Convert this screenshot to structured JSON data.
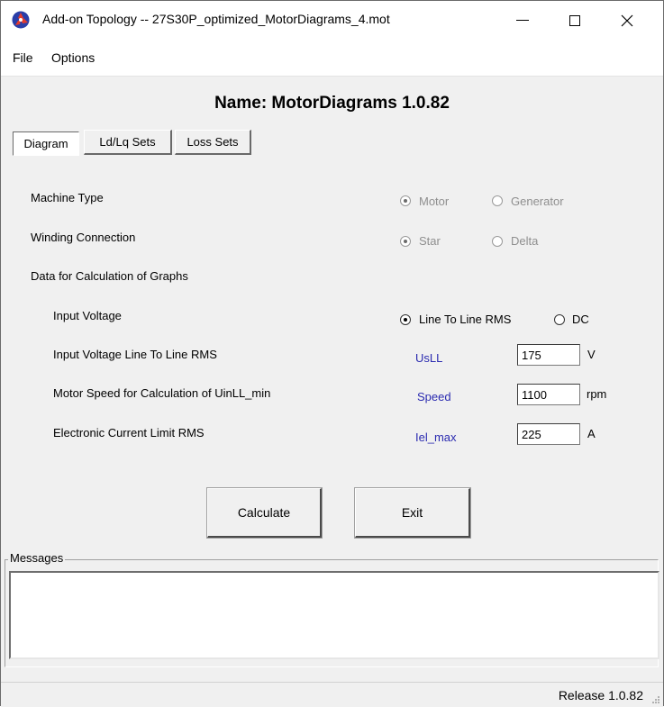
{
  "window": {
    "title": "Add-on Topology -- 27S30P_optimized_MotorDiagrams_4.mot"
  },
  "menu": {
    "items": [
      "File",
      "Options"
    ]
  },
  "heading": "Name: MotorDiagrams 1.0.82",
  "tabs": [
    {
      "label": "Diagram",
      "active": true
    },
    {
      "label": "Ld/Lq Sets",
      "active": false
    },
    {
      "label": "Loss Sets",
      "active": false
    }
  ],
  "form": {
    "machine_type": {
      "label": "Machine Type",
      "options": [
        "Motor",
        "Generator"
      ],
      "selected": "Motor",
      "enabled": false
    },
    "winding_connection": {
      "label": "Winding Connection",
      "options": [
        "Star",
        "Delta"
      ],
      "selected": "Star",
      "enabled": false
    },
    "section_label": "Data for Calculation of Graphs",
    "input_voltage": {
      "label": "Input Voltage",
      "options": [
        "Line To Line RMS",
        "DC"
      ],
      "selected": "Line To Line RMS"
    },
    "fields": [
      {
        "label": "Input Voltage Line To Line RMS",
        "symbol": "UsLL",
        "value": "175",
        "unit": "V"
      },
      {
        "label": "Motor Speed for Calculation of UinLL_min",
        "symbol": "Speed",
        "value": "1100",
        "unit": "rpm"
      },
      {
        "label": "Electronic Current Limit RMS",
        "symbol": "Iel_max",
        "value": "225",
        "unit": "A"
      }
    ]
  },
  "buttons": {
    "calculate": "Calculate",
    "exit": "Exit"
  },
  "messages": {
    "title": "Messages",
    "content": ""
  },
  "status": {
    "release": "Release 1.0.82"
  },
  "colors": {
    "accent_blue": "#2b2bb0",
    "disabled_text": "#8f8f8f",
    "window_bg": "#f0f0f0"
  }
}
